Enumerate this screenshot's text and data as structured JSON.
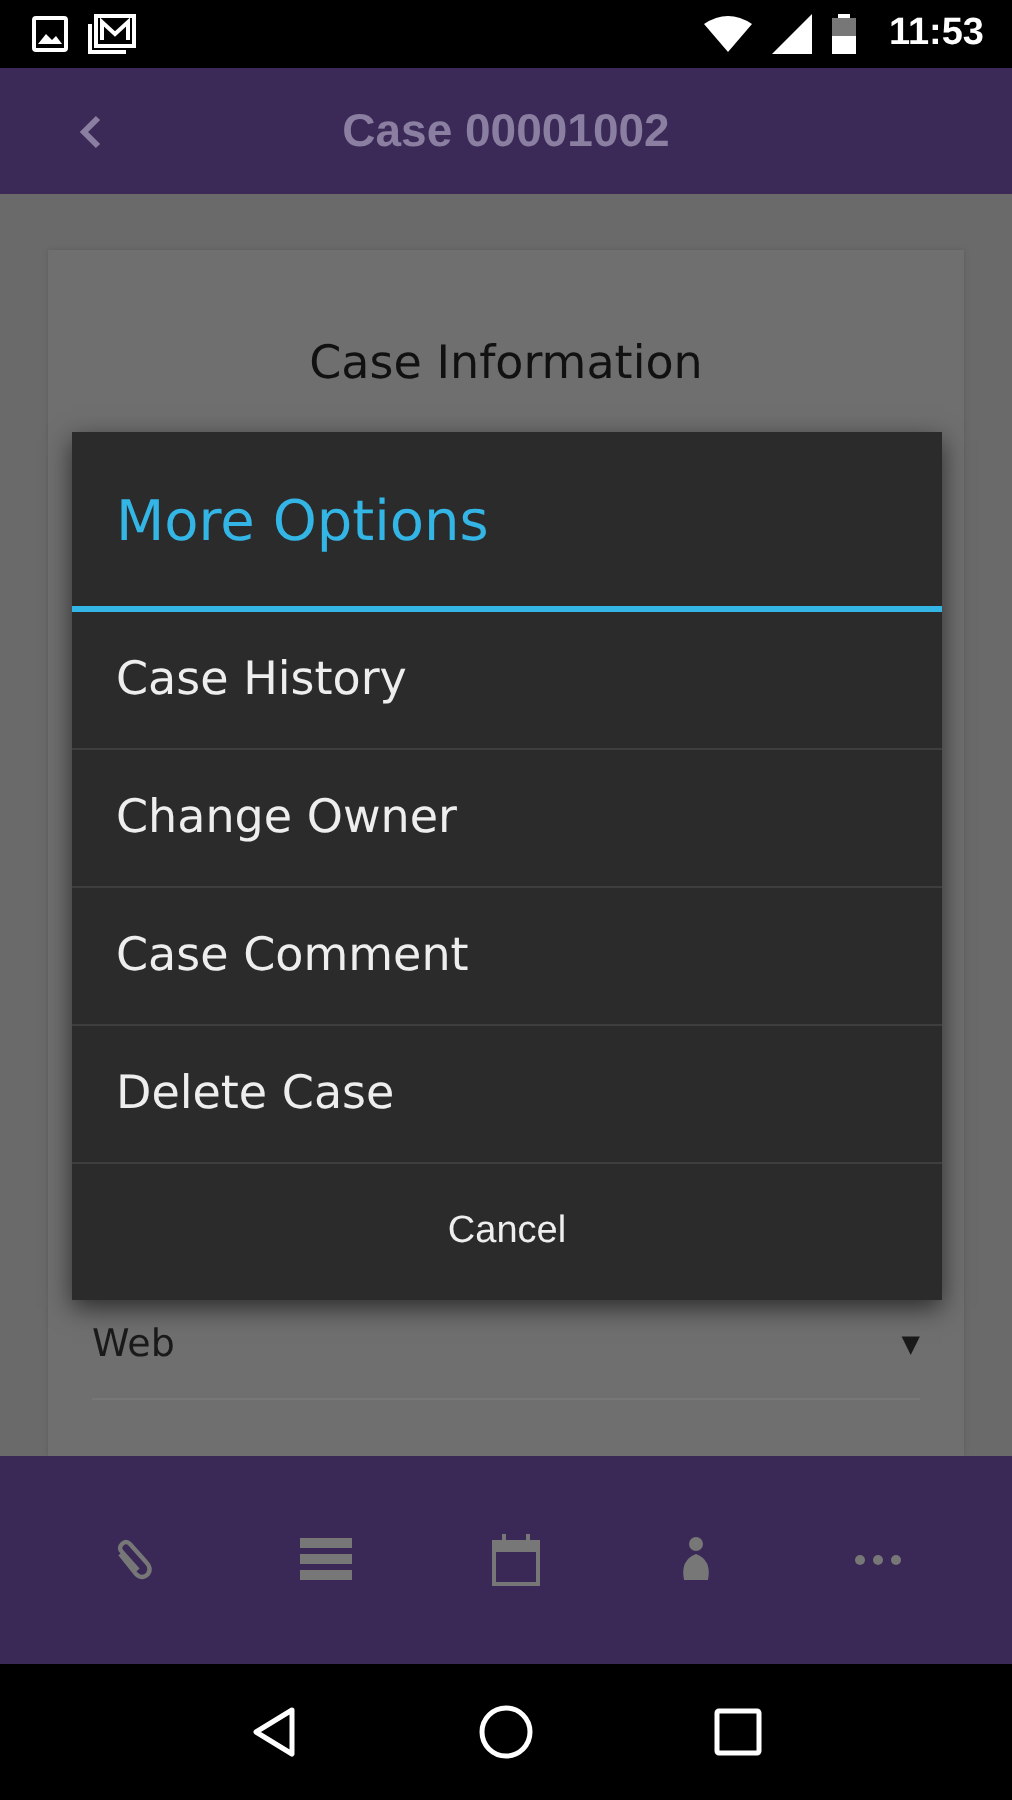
{
  "status_bar": {
    "time": "11:53"
  },
  "app_bar": {
    "title": "Case 00001002"
  },
  "card": {
    "title": "Case Information",
    "dropdown": {
      "value": "Web",
      "arrow": "▼"
    }
  },
  "dialog": {
    "title": "More Options",
    "options": [
      {
        "label": "Case History"
      },
      {
        "label": "Change Owner"
      },
      {
        "label": "Case Comment"
      },
      {
        "label": "Delete Case"
      }
    ],
    "cancel": "Cancel"
  },
  "bottom_bar": {
    "items": [
      {
        "kind": "attachment"
      },
      {
        "kind": "list"
      },
      {
        "kind": "calendar"
      },
      {
        "kind": "person"
      },
      {
        "kind": "more"
      }
    ]
  }
}
